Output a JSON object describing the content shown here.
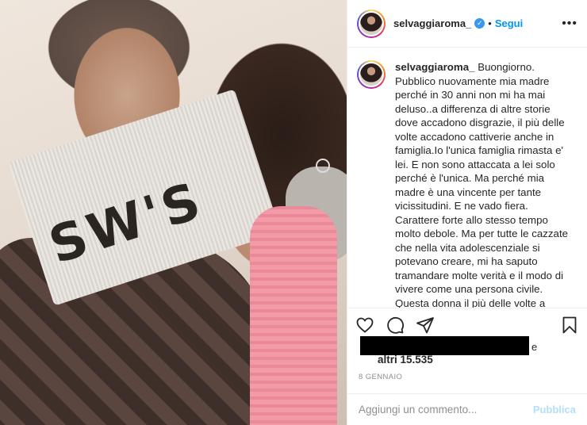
{
  "post": {
    "username": "selvaggiaroma_",
    "follow_label": "Segui",
    "more_label": "•••",
    "separator": "•",
    "verified_glyph": "✓",
    "image_text": "SW'S",
    "caption_username": "selvaggiaroma_",
    "caption": " Buongiorno.\nPubblico nuovamente mia madre\nperché in 30 anni non mi ha mai\ndeluso..a differenza di altre storie\ndove accadono disgrazie, il più delle\nvolte accadono cattiverie anche in\nfamiglia.Io l'unica famiglia rimasta e'\nlei. E non sono attaccata a lei solo\nperché è l'unica. Ma perché mia\nmadre è una vincente per tante\nvicissitudini. E ne vado fiera.\nCarattere forte allo stesso tempo\nmolto debole. Ma per tutte le cazzate\nche nella vita adolescenziale si\npotevano creare, mi ha saputo\ntramandare molte verità e il modo di\nvivere come una persona civile.\nQuesta donna il più delle volte a\ncercato di essere una spalla per me",
    "likes_trail": "e",
    "likes_count": "altri 15.535",
    "date": "8 GENNAIO"
  },
  "icons": {
    "like": "heart-icon",
    "comment": "comment-icon",
    "share": "send-icon",
    "save": "bookmark-icon",
    "verified": "verified-badge-icon"
  },
  "comment_box": {
    "placeholder": "Aggiungi un commento...",
    "submit_label": "Pubblica"
  },
  "colors": {
    "accent": "#0095f6",
    "verified": "#3897f0",
    "publish_disabled": "#b2dffc",
    "muted": "#8e8e8e"
  }
}
